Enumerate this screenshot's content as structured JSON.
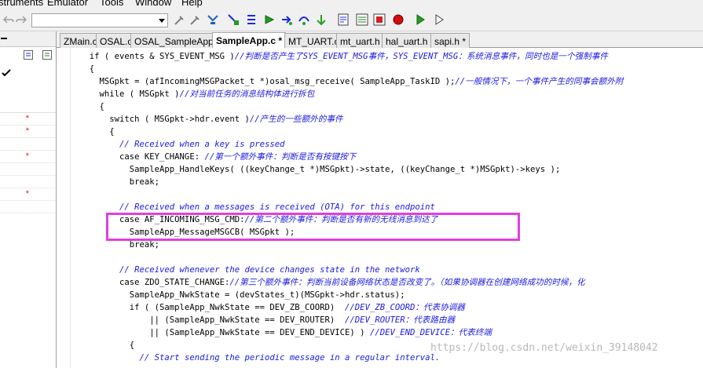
{
  "menu": {
    "items": [
      "struments",
      "Emulator",
      "Tools",
      "Window",
      "Help"
    ]
  },
  "tabs": [
    {
      "label": "ZMain.c"
    },
    {
      "label": "OSAL.c"
    },
    {
      "label": "OSAL_SampleApp.c"
    },
    {
      "label": "SampleApp.c *"
    },
    {
      "label": "MT_UART.c"
    },
    {
      "label": "mt_uart.h"
    },
    {
      "label": "hal_uart.h"
    },
    {
      "label": "sapi.h *"
    }
  ],
  "code": [
    {
      "segs": [
        {
          "t": "  if ( events & SYS_EVENT_MSG )",
          "c": "kw"
        },
        {
          "t": "//判断是否产生了SYS_EVENT_MSG事件，SYS_EVENT_MSG：系统消息事件，同时也是一个强制事件",
          "c": "cm"
        }
      ]
    },
    {
      "segs": [
        {
          "t": "  {",
          "c": "kw"
        }
      ]
    },
    {
      "segs": [
        {
          "t": "    MSGpkt = (afIncomingMSGPacket_t *)osal_msg_receive( SampleApp_TaskID );",
          "c": "kw"
        },
        {
          "t": "//一般情况下，一个事件产生的同事会额外附",
          "c": "cm"
        }
      ]
    },
    {
      "segs": [
        {
          "t": "    while ( MSGpkt )",
          "c": "kw"
        },
        {
          "t": "//对当前任务的消息结构体进行拆包",
          "c": "cm"
        }
      ]
    },
    {
      "segs": [
        {
          "t": "    {",
          "c": "kw"
        }
      ]
    },
    {
      "segs": [
        {
          "t": "      switch ( MSGpkt->hdr.event )",
          "c": "kw"
        },
        {
          "t": "//产生的一些额外的事件",
          "c": "cm"
        }
      ]
    },
    {
      "segs": [
        {
          "t": "      {",
          "c": "kw"
        }
      ]
    },
    {
      "segs": [
        {
          "t": "        // Received when a key is pressed",
          "c": "cm"
        }
      ]
    },
    {
      "segs": [
        {
          "t": "        case KEY_CHANGE: ",
          "c": "kw"
        },
        {
          "t": "//第一个额外事件：判断是否有按键按下",
          "c": "cm"
        }
      ]
    },
    {
      "segs": [
        {
          "t": "          SampleApp_HandleKeys( ((keyChange_t *)MSGpkt)->state, ((keyChange_t *)MSGpkt)->keys );",
          "c": "kw"
        }
      ]
    },
    {
      "segs": [
        {
          "t": "          break;",
          "c": "kw"
        }
      ]
    },
    {
      "segs": [
        {
          "t": "",
          "c": "kw"
        }
      ]
    },
    {
      "segs": [
        {
          "t": "        // Received when a messages is received (OTA) for this endpoint",
          "c": "cm"
        }
      ]
    },
    {
      "segs": [
        {
          "t": "        case AF_INCOMING_MSG_CMD:",
          "c": "kw"
        },
        {
          "t": "//第二个额外事件：判断是否有新的无线消息到达了",
          "c": "cm"
        }
      ]
    },
    {
      "segs": [
        {
          "t": "          SampleApp_MessageMSGCB( MSGpkt );",
          "c": "kw"
        }
      ]
    },
    {
      "segs": [
        {
          "t": "          break;",
          "c": "kw"
        }
      ]
    },
    {
      "segs": [
        {
          "t": "",
          "c": "kw"
        }
      ]
    },
    {
      "segs": [
        {
          "t": "        // Received whenever the device changes state in the network",
          "c": "cm"
        }
      ]
    },
    {
      "segs": [
        {
          "t": "        case ZDO_STATE_CHANGE:",
          "c": "kw"
        },
        {
          "t": "//第三个额外事件：判断当前设备网络状态是否改变了。（如果协调器在创建网络成功的时候，化",
          "c": "cm"
        }
      ]
    },
    {
      "segs": [
        {
          "t": "          SampleApp_NwkState = (devStates_t)(MSGpkt->hdr.status);",
          "c": "kw"
        }
      ]
    },
    {
      "segs": [
        {
          "t": "          if ( (SampleApp_NwkState == DEV_ZB_COORD)  ",
          "c": "kw"
        },
        {
          "t": "//DEV_ZB_COORD：代表协调器",
          "c": "cm"
        }
      ]
    },
    {
      "segs": [
        {
          "t": "              || (SampleApp_NwkState == DEV_ROUTER)  ",
          "c": "kw"
        },
        {
          "t": "//DEV_ROUTER：代表路由器",
          "c": "cm"
        }
      ]
    },
    {
      "segs": [
        {
          "t": "              || (SampleApp_NwkState == DEV_END_DEVICE) ) ",
          "c": "kw"
        },
        {
          "t": "//DEV_END_DEVICE：代表终端",
          "c": "cm"
        }
      ]
    },
    {
      "segs": [
        {
          "t": "          {",
          "c": "kw"
        }
      ]
    },
    {
      "segs": [
        {
          "t": "            // Start sending the periodic message in a regular interval.",
          "c": "cm"
        }
      ]
    }
  ],
  "watermark": "https://blog.csdn.net/weixin_39148042"
}
